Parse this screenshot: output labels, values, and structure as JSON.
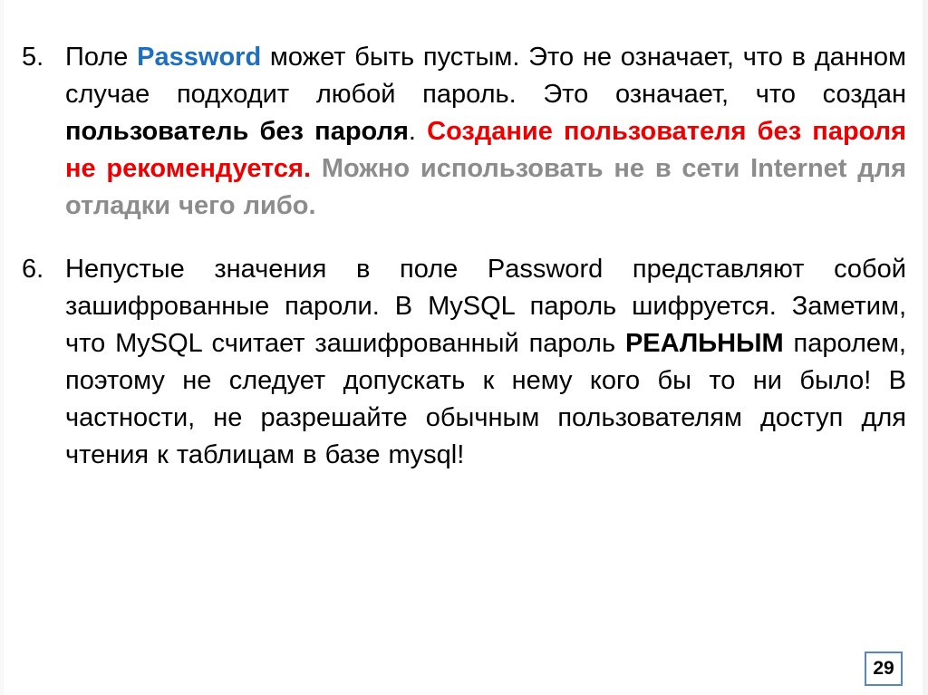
{
  "slide": {
    "page_number": "29",
    "items": [
      {
        "number": "5.",
        "segments": [
          {
            "text": "Поле ",
            "style": "normal"
          },
          {
            "text": "Password",
            "style": "blue-bold"
          },
          {
            "text": " может быть пустым. Это не означает, что в данном случае подходит любой пароль. Это означает, что создан ",
            "style": "normal"
          },
          {
            "text": "пользователь без пароля",
            "style": "bold"
          },
          {
            "text": ". ",
            "style": "normal"
          },
          {
            "text": "Создание пользователя без пароля не рекомендуется.",
            "style": "red-bold"
          },
          {
            "text": " ",
            "style": "normal"
          },
          {
            "text": "Можно использовать не в сети Internet для отладки чего либо.",
            "style": "gray-bold"
          }
        ]
      },
      {
        "number": "6.",
        "segments": [
          {
            "text": "Непустые значения в поле Password представляют собой зашифрованные пароли. В MySQL пароль шифруется. Заметим, что MySQL считает зашифрованный пароль ",
            "style": "normal"
          },
          {
            "text": "РЕАЛЬНЫМ",
            "style": "bold"
          },
          {
            "text": " паролем, поэтому не следует допускать к нему кого бы то ни было! В частности, не разрешайте обычным пользователям доступ для чтения к таблицам в базе mysql!",
            "style": "normal"
          }
        ]
      }
    ]
  },
  "colors": {
    "accent_blue": "#1f6fbf",
    "warning_red": "#ee0000",
    "muted_gray": "#8c8c8c",
    "page_box_border": "#5b84c4"
  }
}
